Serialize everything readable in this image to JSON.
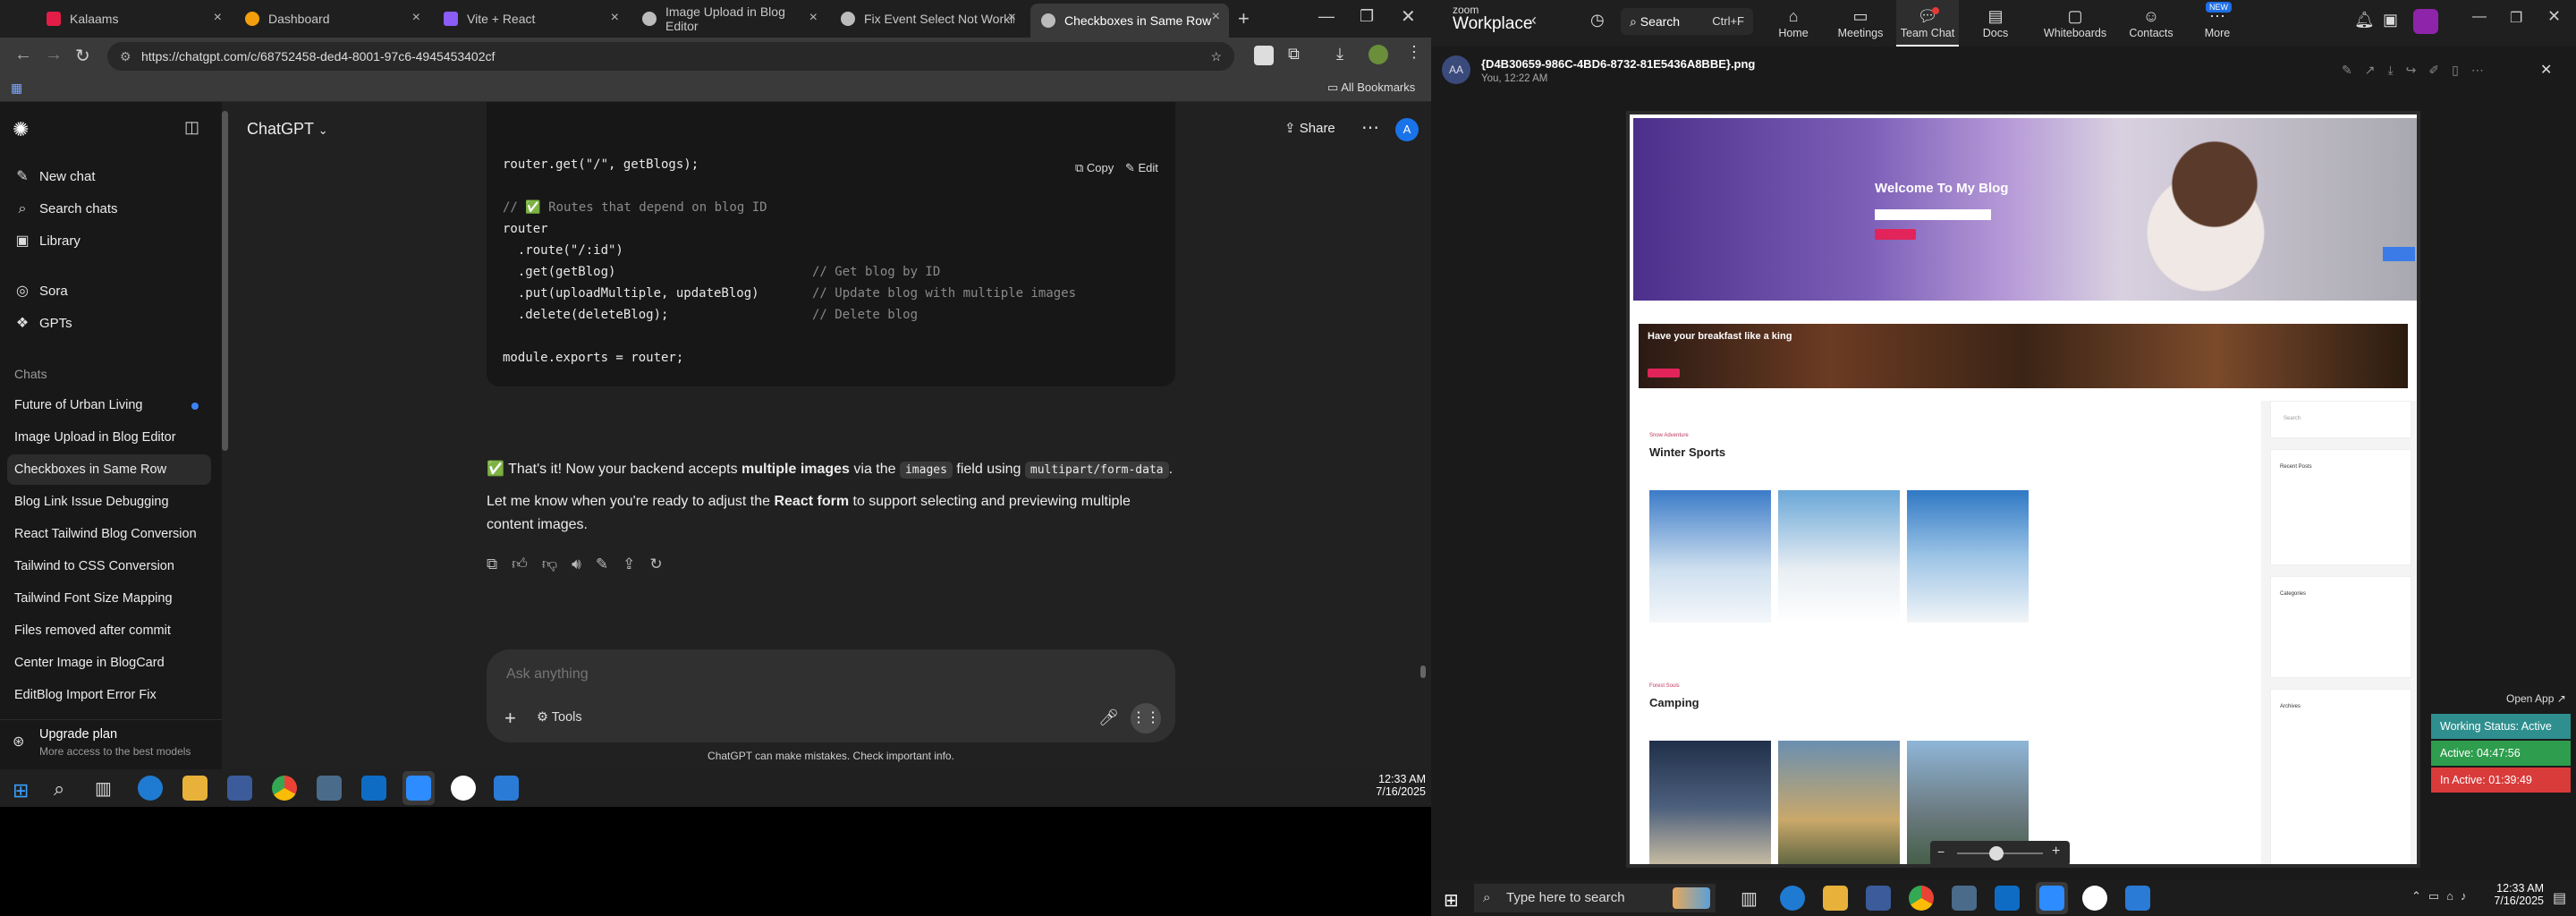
{
  "chrome": {
    "tabs": [
      {
        "title": "Kalaams",
        "color": "#e11d48"
      },
      {
        "title": "Dashboard",
        "color": "#f59e0b"
      },
      {
        "title": "Vite + React",
        "color": "#8b5cf6"
      },
      {
        "title": "Image Upload in Blog Editor",
        "color": "#888888"
      },
      {
        "title": "Fix Event Select Not Working",
        "color": "#888888"
      },
      {
        "title": "Checkboxes in Same Row",
        "color": "#888888"
      }
    ],
    "url": "https://chatgpt.com/c/68752458-ded4-8001-97c6-4945453402cf",
    "bookmarks_label": "All Bookmarks"
  },
  "chatgpt": {
    "model": "ChatGPT",
    "share_label": "Share",
    "avatar": "A",
    "sidebar": {
      "top_items": [
        {
          "label": "New chat",
          "icon": "edit-icon"
        },
        {
          "label": "Search chats",
          "icon": "search-icon"
        },
        {
          "label": "Library",
          "icon": "library-icon"
        }
      ],
      "tools": [
        {
          "label": "Sora",
          "icon": "sora-icon"
        },
        {
          "label": "GPTs",
          "icon": "gpts-icon"
        }
      ],
      "chats_header": "Chats",
      "chats": [
        "Future of Urban Living",
        "Image Upload in Blog Editor",
        "Checkboxes in Same Row",
        "Blog Link Issue Debugging",
        "React Tailwind Blog Conversion",
        "Tailwind to CSS Conversion",
        "Tailwind Font Size Mapping",
        "Files removed after commit",
        "Center Image in BlogCard",
        "EditBlog Import Error Fix"
      ],
      "upgrade_title": "Upgrade plan",
      "upgrade_sub": "More access to the best models"
    },
    "code": {
      "copy_label": "Copy",
      "edit_label": "Edit",
      "l1": "router.get(\"/\", getBlogs);",
      "l2": "// ✅ Routes that depend on blog ID",
      "l3": "router",
      "l4": "  .route(\"/:id\")",
      "l5a": "  .get(getBlog)",
      "l5b": "// Get blog by ID",
      "l6a": "  .put(uploadMultiple, updateBlog)",
      "l6b": "// Update blog with multiple images",
      "l7a": "  .delete(deleteBlog);",
      "l7b": "// Delete blog",
      "l8": "module.exports = router;"
    },
    "answer": {
      "p1_a": "✅ That's it! Now your backend accepts ",
      "p1_b": "multiple images",
      "p1_c": " via the ",
      "p1_d": "images",
      "p1_e": " field using ",
      "p1_f": "multipart/form-data",
      "p1_g": ".",
      "p2_a": "Let me know when you're ready to adjust the ",
      "p2_b": "React form",
      "p2_c": " to support selecting and previewing multiple content images."
    },
    "composer": {
      "placeholder": "Ask anything",
      "tools_label": "Tools"
    },
    "disclaimer": "ChatGPT can make mistakes. Check important info."
  },
  "taskbar_left": {
    "time": "12:33 AM",
    "date": "7/16/2025"
  },
  "zoom": {
    "brand_top": "zoom",
    "brand": "Workplace",
    "search": "Search",
    "search_shortcut": "Ctrl+F",
    "nav": [
      "Home",
      "Meetings",
      "Team Chat",
      "Docs",
      "Whiteboards",
      "Contacts",
      "More"
    ],
    "new_badge": "NEW",
    "avatar": "AA",
    "file_name": "{D4B30659-986C-4BD6-8732-81E5436A8BBE}.png",
    "sender_time": "You, 12:22 AM",
    "open_app": "Open App ↗",
    "status": [
      {
        "label": "Working Status: Active",
        "color": "#2f8f8f"
      },
      {
        "label": "Active: 04:47:56",
        "color": "#2e9e4e"
      },
      {
        "label": "In Active: 01:39:49",
        "color": "#d93a3a"
      }
    ],
    "blog": {
      "hero_title": "Welcome To My Blog",
      "banner_text": "Have your breakfast like a king",
      "section1_tag": "Snow Adventure",
      "section1_title": "Winter Sports",
      "section2_tag": "Forest Souls",
      "section2_title": "Camping",
      "recent_posts": "Recent Posts",
      "categories": "Categories",
      "archives": "Archives",
      "search_ph": "Search"
    }
  },
  "taskbar_right": {
    "search_ph": "Type here to search",
    "time": "12:33 AM",
    "date": "7/16/2025"
  }
}
